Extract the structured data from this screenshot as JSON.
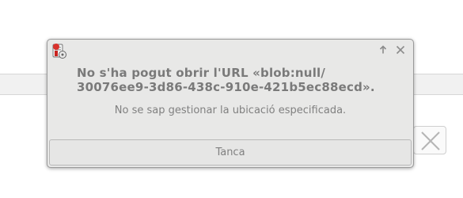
{
  "dialog": {
    "title_line1": "No s'ha pogut obrir l'URL «blob:null/",
    "title_line2": "30076ee9-3d86-438c-910e-421b5ec88ecd».",
    "message": "No se sap gestionar la ubicació especificada.",
    "button_label": "Tanca",
    "icons": {
      "app": "firefox-download-icon",
      "maximize": "arrow-up-icon",
      "close": "close-icon"
    }
  },
  "background": {
    "icons": {
      "close": "close-icon"
    }
  }
}
